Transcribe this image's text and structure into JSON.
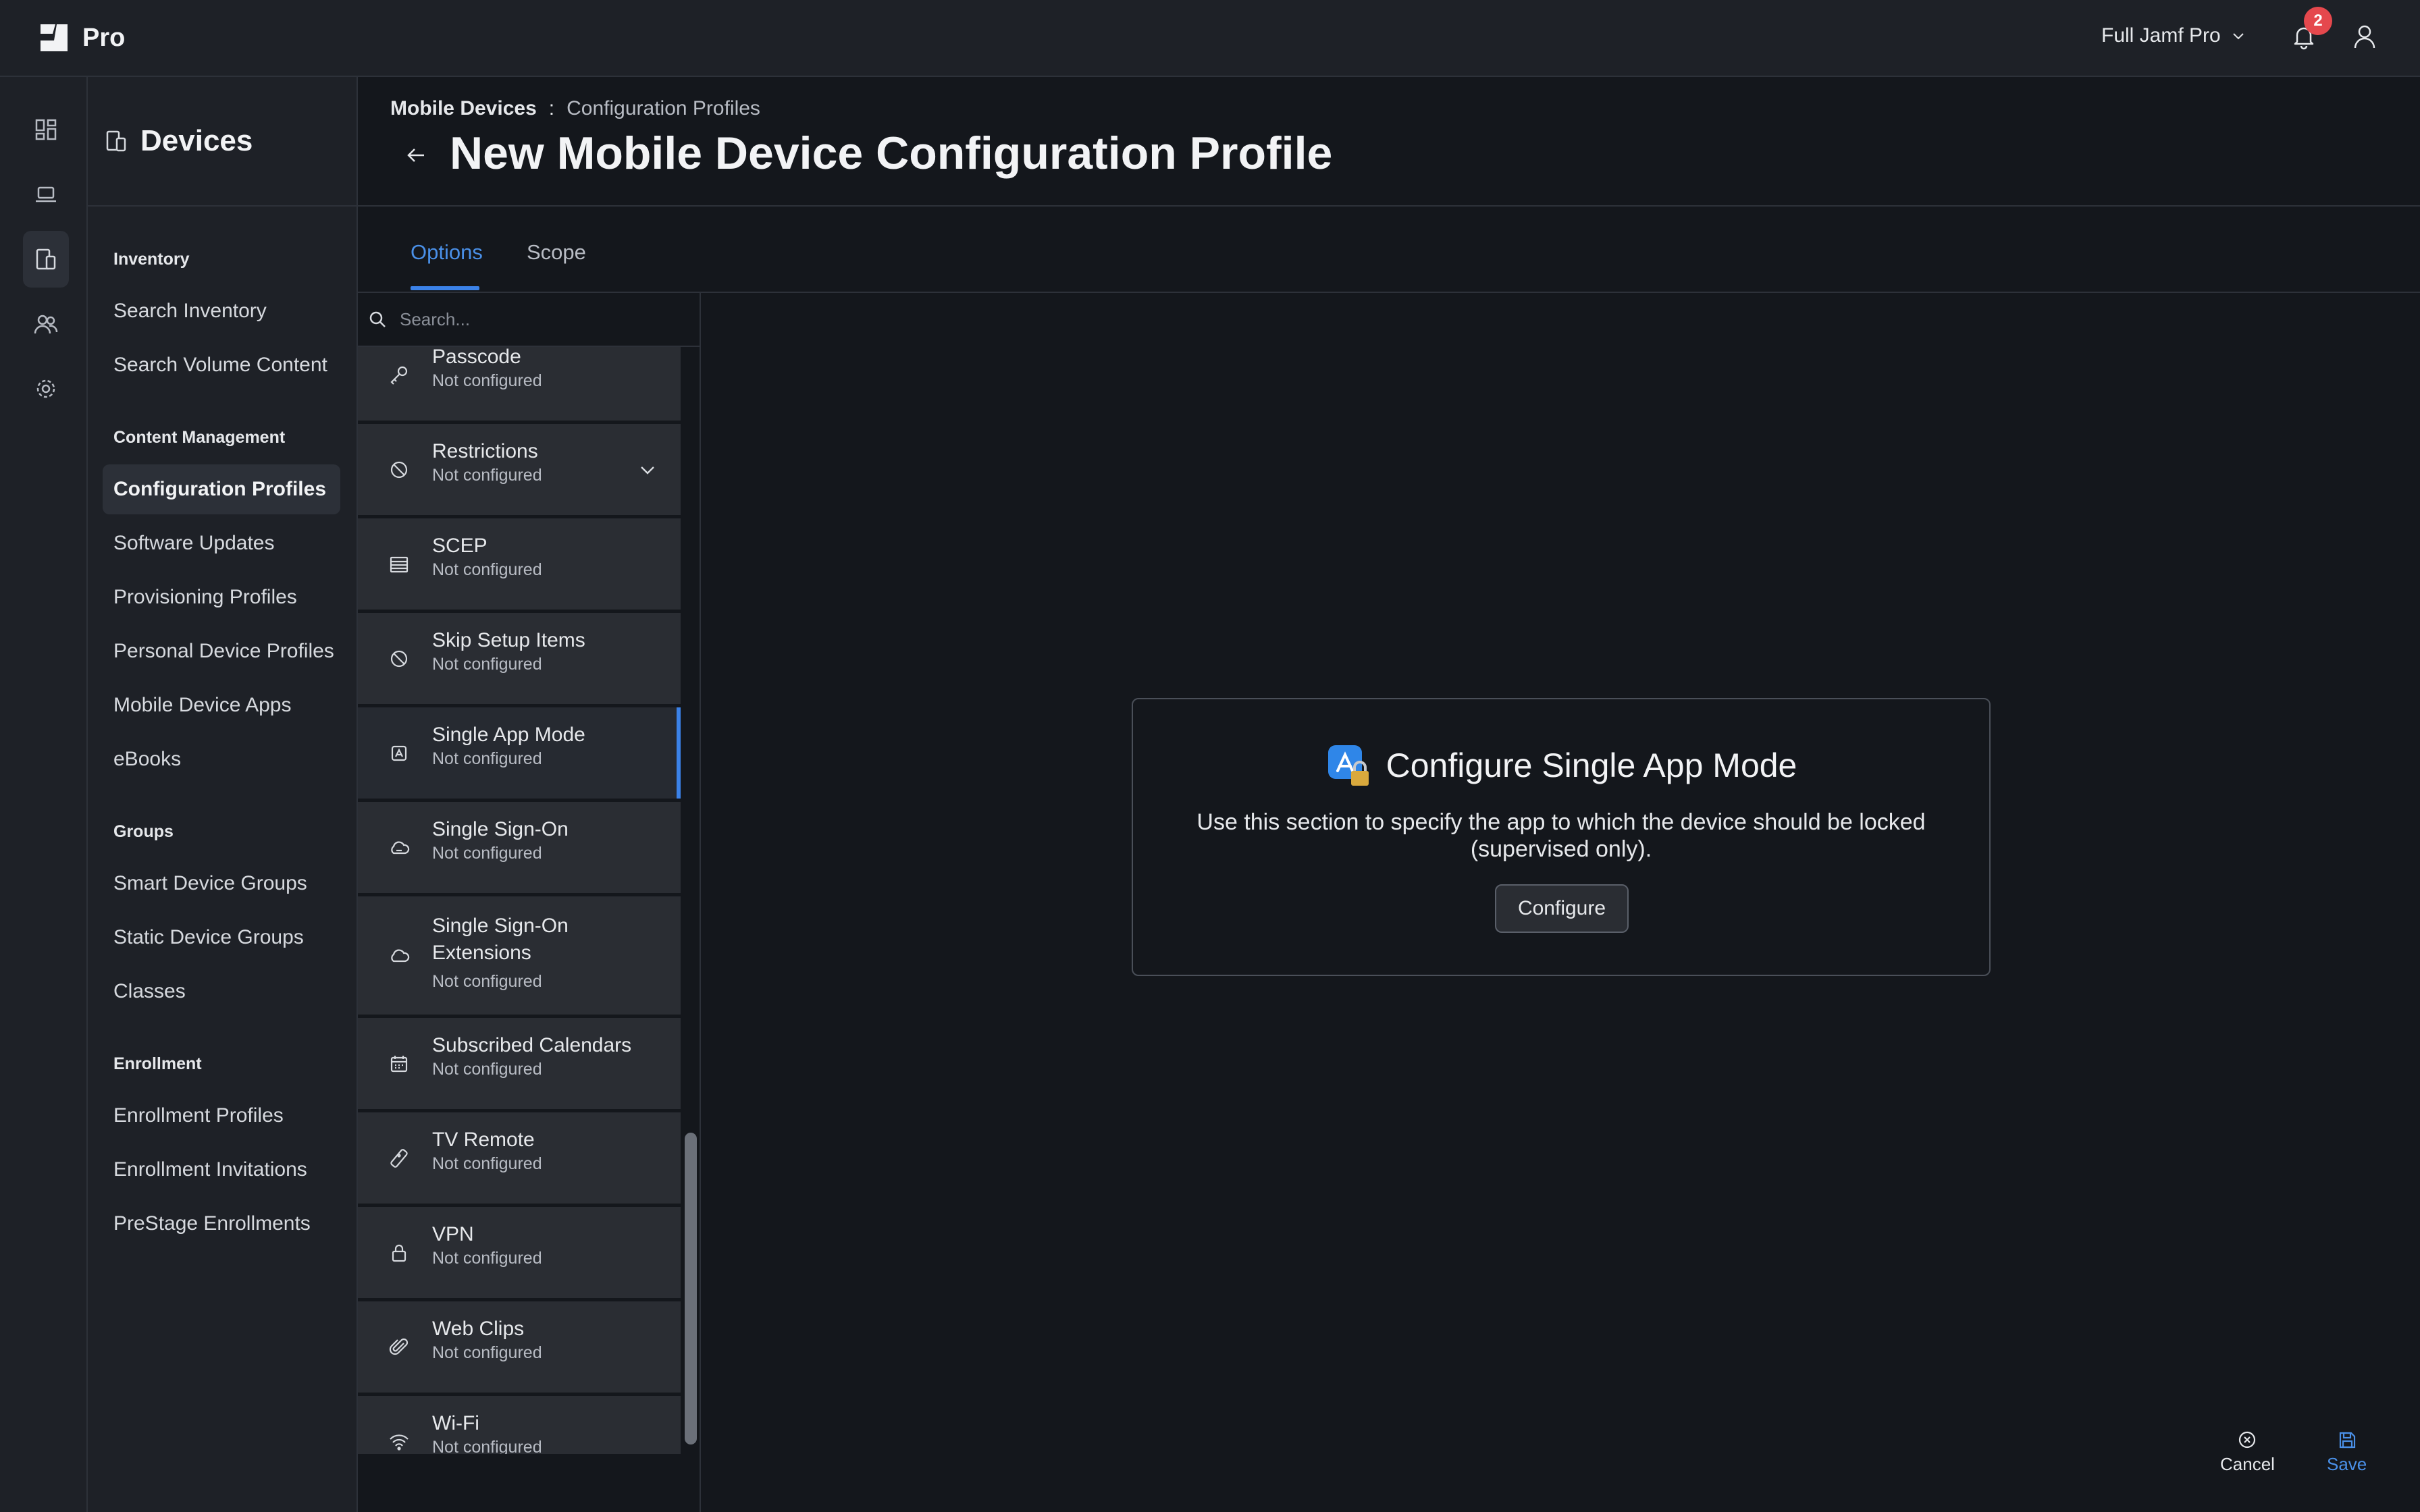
{
  "app": {
    "name": "Pro",
    "environment": "Full Jamf Pro",
    "notifications_count": "2"
  },
  "sidebar": {
    "title": "Devices",
    "groups": [
      {
        "title": "Inventory",
        "items": [
          "Search Inventory",
          "Search Volume Content"
        ]
      },
      {
        "title": "Content Management",
        "items": [
          "Configuration Profiles",
          "Software Updates",
          "Provisioning Profiles",
          "Personal Device Profiles",
          "Mobile Device Apps",
          "eBooks"
        ]
      },
      {
        "title": "Groups",
        "items": [
          "Smart Device Groups",
          "Static Device Groups",
          "Classes"
        ]
      },
      {
        "title": "Enrollment",
        "items": [
          "Enrollment Profiles",
          "Enrollment Invitations",
          "PreStage Enrollments"
        ]
      }
    ],
    "active_item": "Configuration Profiles"
  },
  "header": {
    "breadcrumb": [
      "Mobile Devices",
      "Configuration Profiles"
    ],
    "breadcrumb_separator": ":",
    "title": "New Mobile Device Configuration Profile"
  },
  "tabs": [
    {
      "label": "Options",
      "active": true
    },
    {
      "label": "Scope",
      "active": false
    }
  ],
  "options_panel": {
    "search_placeholder": "Search...",
    "items": [
      {
        "name": "Passcode",
        "status": "Not configured",
        "icon": "key-icon"
      },
      {
        "name": "Restrictions",
        "status": "Not configured",
        "icon": "prohibited-icon",
        "expandable": true
      },
      {
        "name": "SCEP",
        "status": "Not configured",
        "icon": "certificate-list-icon"
      },
      {
        "name": "Skip Setup Items",
        "status": "Not configured",
        "icon": "prohibited-icon"
      },
      {
        "name": "Single App Mode",
        "status": "Not configured",
        "icon": "app-store-icon",
        "active": true
      },
      {
        "name": "Single Sign-On",
        "status": "Not configured",
        "icon": "cloud-key-icon"
      },
      {
        "name": "Single Sign-On Extensions",
        "status": "Not configured",
        "icon": "cloud-puzzle-icon"
      },
      {
        "name": "Subscribed Calendars",
        "status": "Not configured",
        "icon": "calendar-icon"
      },
      {
        "name": "TV Remote",
        "status": "Not configured",
        "icon": "remote-icon"
      },
      {
        "name": "VPN",
        "status": "Not configured",
        "icon": "lock-icon"
      },
      {
        "name": "Web Clips",
        "status": "Not configured",
        "icon": "paperclip-icon"
      },
      {
        "name": "Wi-Fi",
        "status": "Not configured",
        "icon": "wifi-icon"
      }
    ]
  },
  "main": {
    "card_title": "Configure Single App Mode",
    "card_description": "Use this section to specify the app to which the device should be locked (supervised only).",
    "configure_label": "Configure"
  },
  "footer": {
    "cancel_label": "Cancel",
    "save_label": "Save"
  },
  "colors": {
    "accent": "#3b82e8",
    "badge": "#e5484d",
    "panel": "#1e2127",
    "background": "#14171c",
    "list_item": "#2a2d33"
  }
}
